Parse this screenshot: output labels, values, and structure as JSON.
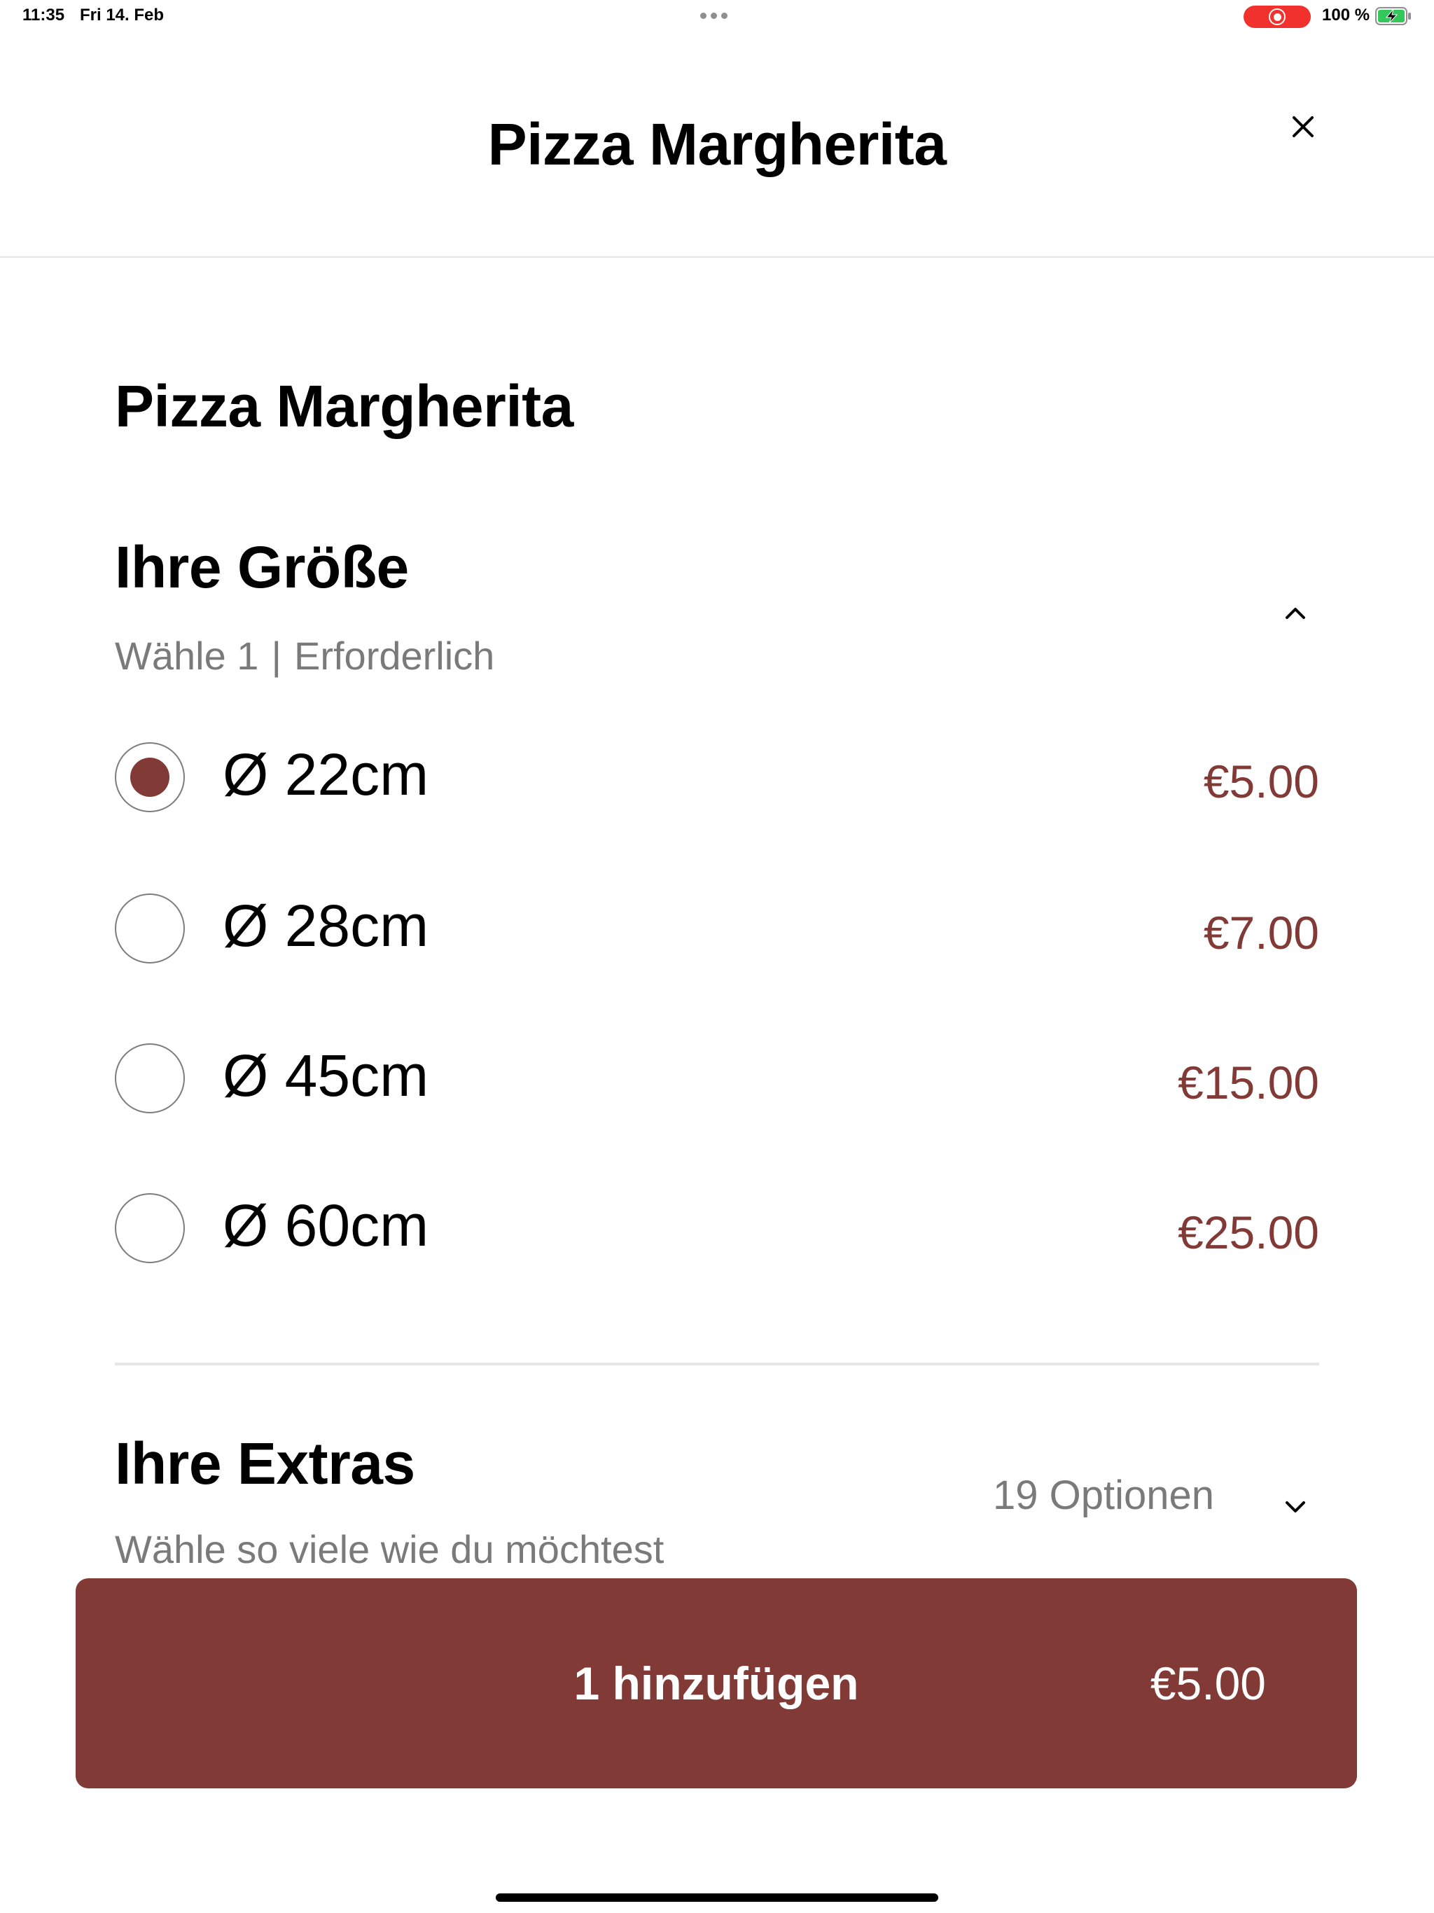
{
  "status_bar": {
    "time": "11:35",
    "date": "Fri 14. Feb",
    "battery": "100 %",
    "record_color": "#f0312c",
    "battery_icon": "battery-charging-icon"
  },
  "header": {
    "title": "Pizza Margherita",
    "close_icon": "close-icon"
  },
  "item": {
    "title": "Pizza Margherita"
  },
  "size_group": {
    "title": "Ihre Größe",
    "choose": "Wähle 1",
    "separator": "|",
    "required": "Erforderlich",
    "expanded": true,
    "chevron_icon": "chevron-up-icon",
    "options": [
      {
        "label": "Ø 22cm",
        "price": "€5.00",
        "selected": true
      },
      {
        "label": "Ø 28cm",
        "price": "€7.00",
        "selected": false
      },
      {
        "label": "Ø 45cm",
        "price": "€15.00",
        "selected": false
      },
      {
        "label": "Ø 60cm",
        "price": "€25.00",
        "selected": false
      }
    ]
  },
  "extras_group": {
    "title": "Ihre Extras",
    "subtitle": "Wähle so viele wie du möchtest",
    "count": "19 Optionen",
    "expanded": false,
    "chevron_icon": "chevron-down-icon"
  },
  "add_button": {
    "label": "1 hinzufügen",
    "price": "€5.00"
  },
  "colors": {
    "accent": "#813a35",
    "secondary_text": "#7a7a7a",
    "divider": "#e6e6e6"
  }
}
